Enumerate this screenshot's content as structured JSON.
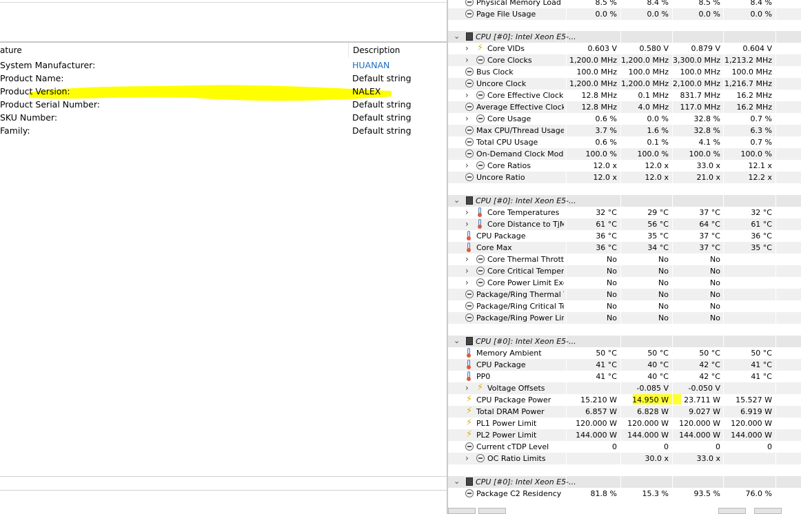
{
  "left": {
    "header_feature": "ature",
    "header_description": "Description",
    "rows": [
      {
        "feature": "System Manufacturer:",
        "description": "HUANAN",
        "link": true
      },
      {
        "feature": "Product Name:",
        "description": "Default string",
        "link": false
      },
      {
        "feature": "Product Version:",
        "description": "NALEX",
        "link": false
      },
      {
        "feature": "Product Serial Number:",
        "description": "Default string",
        "link": false
      },
      {
        "feature": "SKU Number:",
        "description": "Default string",
        "link": false
      },
      {
        "feature": "Family:",
        "description": "Default string",
        "link": false
      }
    ],
    "highlight_color": "#ffff00"
  },
  "right": {
    "top_rows": [
      {
        "name": "Physical Memory Load",
        "v": [
          "8.5 %",
          "8.4 %",
          "8.5 %",
          "8.4 %"
        ]
      },
      {
        "name": "Page File Usage",
        "v": [
          "0.0 %",
          "0.0 %",
          "0.0 %",
          "0.0 %"
        ]
      }
    ],
    "sections": [
      {
        "title": "CPU [#0]: Intel Xeon E5-...",
        "rows": [
          {
            "name": "Core VIDs",
            "icon": "bolt",
            "expand": true,
            "v": [
              "0.603 V",
              "0.580 V",
              "0.879 V",
              "0.604 V"
            ]
          },
          {
            "name": "Core Clocks",
            "icon": "circle",
            "expand": true,
            "v": [
              "1,200.0 MHz",
              "1,200.0 MHz",
              "3,300.0 MHz",
              "1,213.2 MHz"
            ]
          },
          {
            "name": "Bus Clock",
            "icon": "circle",
            "expand": false,
            "v": [
              "100.0 MHz",
              "100.0 MHz",
              "100.0 MHz",
              "100.0 MHz"
            ]
          },
          {
            "name": "Uncore Clock",
            "icon": "circle",
            "expand": false,
            "v": [
              "1,200.0 MHz",
              "1,200.0 MHz",
              "2,100.0 MHz",
              "1,216.7 MHz"
            ]
          },
          {
            "name": "Core Effective Clocks",
            "icon": "circle",
            "expand": true,
            "v": [
              "12.8 MHz",
              "0.1 MHz",
              "831.7 MHz",
              "16.2 MHz"
            ]
          },
          {
            "name": "Average Effective Clock",
            "icon": "circle",
            "expand": false,
            "v": [
              "12.8 MHz",
              "4.0 MHz",
              "117.0 MHz",
              "16.2 MHz"
            ]
          },
          {
            "name": "Core Usage",
            "icon": "circle",
            "expand": true,
            "v": [
              "0.6 %",
              "0.0 %",
              "32.8 %",
              "0.7 %"
            ]
          },
          {
            "name": "Max CPU/Thread Usage",
            "icon": "circle",
            "expand": false,
            "v": [
              "3.7 %",
              "1.6 %",
              "32.8 %",
              "6.3 %"
            ]
          },
          {
            "name": "Total CPU Usage",
            "icon": "circle",
            "expand": false,
            "v": [
              "0.6 %",
              "0.1 %",
              "4.1 %",
              "0.7 %"
            ]
          },
          {
            "name": "On-Demand Clock Modul...",
            "icon": "circle",
            "expand": false,
            "v": [
              "100.0 %",
              "100.0 %",
              "100.0 %",
              "100.0 %"
            ]
          },
          {
            "name": "Core Ratios",
            "icon": "circle",
            "expand": true,
            "v": [
              "12.0 x",
              "12.0 x",
              "33.0 x",
              "12.1 x"
            ]
          },
          {
            "name": "Uncore Ratio",
            "icon": "circle",
            "expand": false,
            "v": [
              "12.0 x",
              "12.0 x",
              "21.0 x",
              "12.2 x"
            ]
          }
        ]
      },
      {
        "title": "CPU [#0]: Intel Xeon E5-...",
        "rows": [
          {
            "name": "Core Temperatures",
            "icon": "therm",
            "expand": true,
            "v": [
              "32 °C",
              "29 °C",
              "37 °C",
              "32 °C"
            ]
          },
          {
            "name": "Core Distance to TjMAX",
            "icon": "therm",
            "expand": true,
            "v": [
              "61 °C",
              "56 °C",
              "64 °C",
              "61 °C"
            ]
          },
          {
            "name": "CPU Package",
            "icon": "therm",
            "expand": false,
            "v": [
              "36 °C",
              "35 °C",
              "37 °C",
              "36 °C"
            ]
          },
          {
            "name": "Core Max",
            "icon": "therm",
            "expand": false,
            "v": [
              "36 °C",
              "34 °C",
              "37 °C",
              "35 °C"
            ]
          },
          {
            "name": "Core Thermal Throttling",
            "icon": "circle",
            "expand": true,
            "v": [
              "No",
              "No",
              "No",
              ""
            ]
          },
          {
            "name": "Core Critical Tempera...",
            "icon": "circle",
            "expand": true,
            "v": [
              "No",
              "No",
              "No",
              ""
            ]
          },
          {
            "name": "Core Power Limit Exc...",
            "icon": "circle",
            "expand": true,
            "v": [
              "No",
              "No",
              "No",
              ""
            ]
          },
          {
            "name": "Package/Ring Thermal Th...",
            "icon": "circle",
            "expand": false,
            "v": [
              "No",
              "No",
              "No",
              ""
            ]
          },
          {
            "name": "Package/Ring Critical Te...",
            "icon": "circle",
            "expand": false,
            "v": [
              "No",
              "No",
              "No",
              ""
            ]
          },
          {
            "name": "Package/Ring Power Limi...",
            "icon": "circle",
            "expand": false,
            "v": [
              "No",
              "No",
              "No",
              ""
            ]
          }
        ]
      },
      {
        "title": "CPU [#0]: Intel Xeon E5-...",
        "rows": [
          {
            "name": "Memory Ambient",
            "icon": "therm",
            "expand": false,
            "v": [
              "50 °C",
              "50 °C",
              "50 °C",
              "50 °C"
            ]
          },
          {
            "name": "CPU Package",
            "icon": "therm",
            "expand": false,
            "v": [
              "41 °C",
              "40 °C",
              "42 °C",
              "41 °C"
            ]
          },
          {
            "name": "PP0",
            "icon": "therm",
            "expand": false,
            "v": [
              "41 °C",
              "40 °C",
              "42 °C",
              "41 °C"
            ]
          },
          {
            "name": "Voltage Offsets",
            "icon": "bolt",
            "expand": true,
            "v": [
              "",
              "-0.085 V",
              "-0.050 V",
              ""
            ]
          },
          {
            "name": "CPU Package Power",
            "icon": "bolt",
            "expand": false,
            "v": [
              "15.210 W",
              "14.950 W",
              "23.711 W",
              "15.527 W"
            ]
          },
          {
            "name": "Total DRAM Power",
            "icon": "bolt",
            "expand": false,
            "v": [
              "6.857 W",
              "6.828 W",
              "9.027 W",
              "6.919 W"
            ]
          },
          {
            "name": "PL1 Power Limit",
            "icon": "bolt",
            "expand": false,
            "v": [
              "120.000 W",
              "120.000 W",
              "120.000 W",
              "120.000 W"
            ]
          },
          {
            "name": "PL2 Power Limit",
            "icon": "bolt",
            "expand": false,
            "v": [
              "144.000 W",
              "144.000 W",
              "144.000 W",
              "144.000 W"
            ]
          },
          {
            "name": "Current cTDP Level",
            "icon": "circle",
            "expand": false,
            "v": [
              "0",
              "0",
              "0",
              "0"
            ]
          },
          {
            "name": "OC Ratio Limits",
            "icon": "circle",
            "expand": true,
            "v": [
              "",
              "30.0 x",
              "33.0 x",
              ""
            ]
          }
        ]
      },
      {
        "title": "CPU [#0]: Intel Xeon E5-...",
        "rows": [
          {
            "name": "Package C2 Residency",
            "icon": "circle",
            "expand": false,
            "v": [
              "81.8 %",
              "15.3 %",
              "93.5 %",
              "76.0 %"
            ]
          }
        ]
      }
    ],
    "highlight_color": "#ffff33"
  }
}
